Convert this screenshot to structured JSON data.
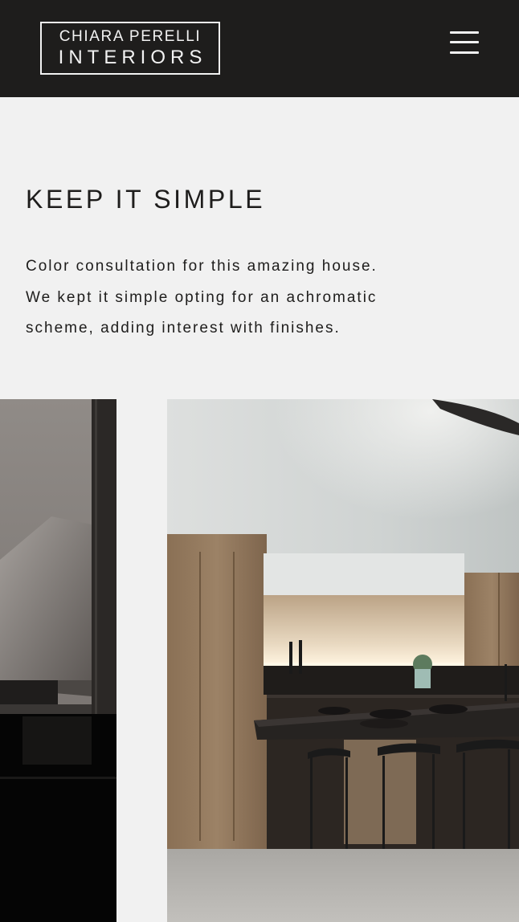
{
  "header": {
    "logo_line1": "CHIARA PERELLI",
    "logo_line2": "INTERIORS",
    "menu_icon": "hamburger-menu-icon"
  },
  "content": {
    "title": "KEEP IT SIMPLE",
    "description_lines": [
      "Color consultation for this amazing house.",
      "We kept it simple opting for an achromatic",
      "scheme, adding interest with finishes."
    ]
  },
  "colors": {
    "header_bg": "#1e1d1c",
    "page_bg": "#f1f1f1",
    "text": "#1e1d1c",
    "logo": "#f2f2f2"
  }
}
